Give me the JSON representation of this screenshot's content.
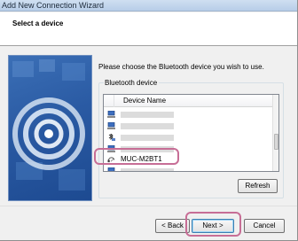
{
  "window": {
    "title": "Add New Connection Wizard"
  },
  "header": {
    "title": "Select a device"
  },
  "main": {
    "instruction": "Please choose the Bluetooth device you wish to use.",
    "group_label": "Bluetooth device",
    "column_header": "Device Name",
    "devices": [
      {
        "icon": "computer-icon",
        "label": ""
      },
      {
        "icon": "computer-icon",
        "label": ""
      },
      {
        "icon": "bluetooth-device-icon",
        "label": ""
      },
      {
        "icon": "computer-icon",
        "label": ""
      },
      {
        "icon": "headset-icon",
        "label": "MUC-M2BT1"
      },
      {
        "icon": "computer-icon",
        "label": ""
      }
    ],
    "refresh_label": "Refresh"
  },
  "footer": {
    "back_label": "< Back",
    "next_label": "Next >",
    "cancel_label": "Cancel"
  },
  "colors": {
    "highlight": "#c76e96",
    "header_bg": "#ffffff",
    "dialog_bg": "#f0f0f0",
    "banner_blue": "#2a5aa3"
  }
}
